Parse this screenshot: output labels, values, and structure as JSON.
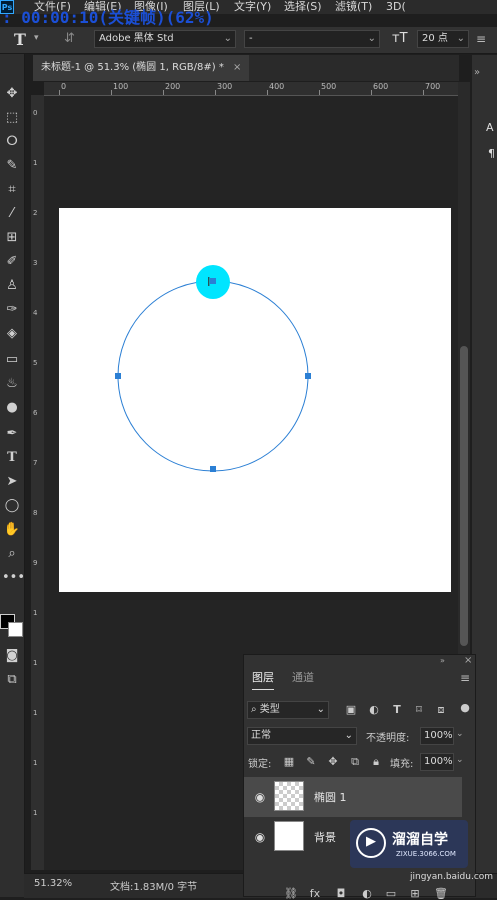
{
  "menubar": {
    "logo": "Ps",
    "items": [
      "文件(F)",
      "编辑(E)",
      "图像(I)",
      "图层(L)",
      "文字(Y)",
      "选择(S)",
      "滤镜(T)",
      "3D("
    ],
    "keyframe_overlay": ": 00:00:10(关键帧)(62%)"
  },
  "options": {
    "tool_icon": "T",
    "font_family": "Adobe 黑体 Std",
    "font_style": "-",
    "size_value": "20 点"
  },
  "document": {
    "tab_title": "未标题-1 @ 51.3% (椭圆 1, RGB/8#) *",
    "tab_close": "×",
    "ruler_h_labels": [
      "0",
      "100",
      "200",
      "300",
      "400",
      "500",
      "600",
      "700",
      "80"
    ],
    "ruler_v_labels": [
      "0",
      "1",
      "2",
      "3",
      "4",
      "5",
      "6",
      "7",
      "8",
      "9",
      "1",
      "1",
      "1",
      "1",
      "1"
    ]
  },
  "statusbar": {
    "zoom": "51.32%",
    "doc_info": "文档:1.83M/0 字节"
  },
  "layers_panel": {
    "tab_layers": "图层",
    "tab_channels": "通道",
    "filter_kind": "类型",
    "blend_mode": "正常",
    "opacity_label": "不透明度:",
    "opacity_value": "100%",
    "lock_label": "锁定:",
    "fill_label": "填充:",
    "fill_value": "100%",
    "layers": [
      {
        "name": "椭圆 1",
        "selected": true
      },
      {
        "name": "背景",
        "selected": false
      }
    ]
  },
  "watermark": {
    "title": "溜溜自学",
    "subtitle": "ZIXUE.3066.COM",
    "site": "jingyan.baidu.com"
  },
  "colors": {
    "selection_cyan": "#00e5ff",
    "path_blue": "#2b7fd4"
  }
}
